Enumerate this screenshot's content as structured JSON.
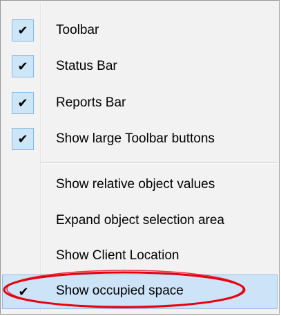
{
  "menu": {
    "checked_items": [
      {
        "label": "Toolbar",
        "checked": true
      },
      {
        "label": "Status Bar",
        "checked": true
      },
      {
        "label": "Reports Bar",
        "checked": true
      },
      {
        "label": "Show large Toolbar buttons",
        "checked": true
      }
    ],
    "unchecked_items": [
      {
        "label": "Show relative object values",
        "checked": false
      },
      {
        "label": "Expand object selection area",
        "checked": false
      },
      {
        "label": "Show Client Location",
        "checked": false
      }
    ],
    "highlighted_item": {
      "label": "Show occupied space",
      "checked": true
    },
    "check_glyph": "✔",
    "icons": {
      "check": "checkmark-icon"
    },
    "colors": {
      "menu_bg": "#f2f2f2",
      "highlight_bg": "#cde3f7",
      "highlight_border": "#8fb8e6",
      "annotation": "#e8000e"
    }
  }
}
